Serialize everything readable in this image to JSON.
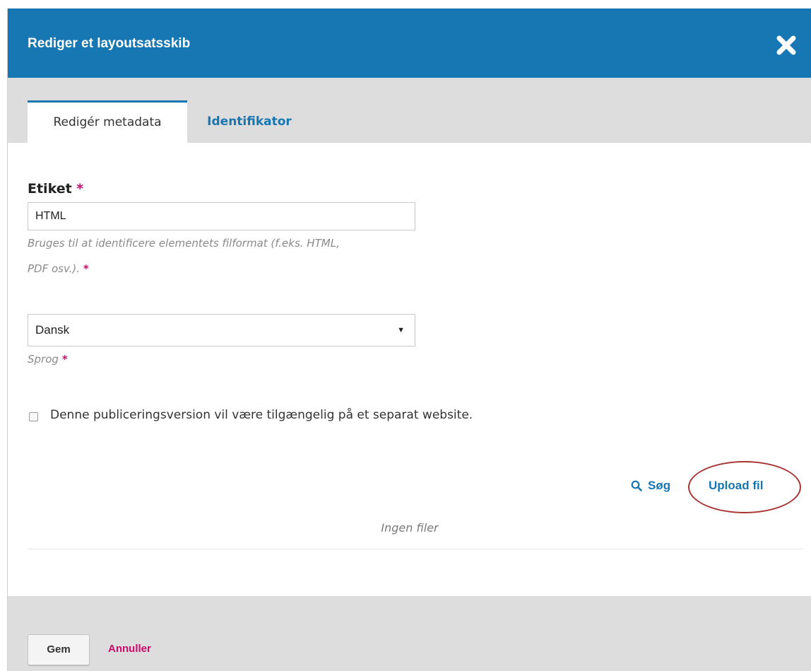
{
  "modal": {
    "title": "Rediger et layoutsatsskib",
    "close_icon": "close-icon"
  },
  "tabs": [
    {
      "label": "Redigér metadata",
      "active": true
    },
    {
      "label": "Identifikator",
      "active": false
    }
  ],
  "form": {
    "label_field": {
      "label": "Etiket",
      "required_mark": "*",
      "value": "HTML",
      "help_line1": "Bruges til at identificere elementets filformat (f.eks. HTML,",
      "help_line2": "PDF osv.).",
      "help_required_mark": "*"
    },
    "language_field": {
      "selected": "Dansk",
      "help": "Sprog",
      "required_mark": "*"
    },
    "remote_checkbox": {
      "label": "Denne publiceringsversion vil være tilgængelig på et separat website.",
      "checked": false
    }
  },
  "files": {
    "search_label": "Søg",
    "search_icon": "search-icon",
    "upload_label": "Upload fil",
    "empty_text": "Ingen filer"
  },
  "footer": {
    "save_label": "Gem",
    "cancel_label": "Annuller"
  },
  "colors": {
    "header": "#1677b3",
    "accent_link": "#1677b3",
    "required": "#d00a6c",
    "annotation_circle": "#a83232"
  }
}
